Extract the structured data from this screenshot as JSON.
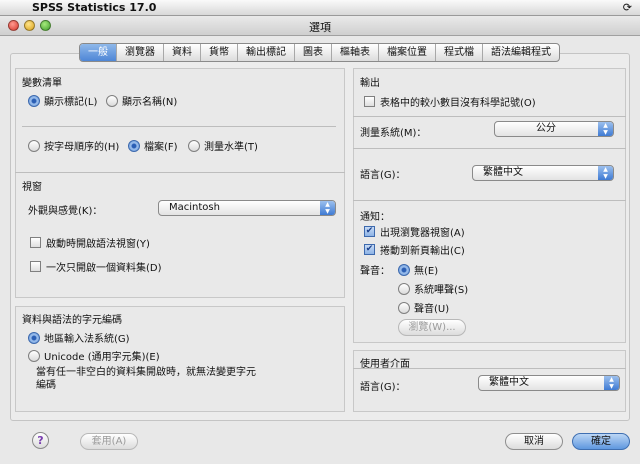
{
  "menubar": {
    "apple": "",
    "app_name": "SPSS Statistics 17.0",
    "sync_icon": "⟳"
  },
  "window": {
    "title": "選項"
  },
  "tabs": [
    "一般",
    "瀏覽器",
    "資料",
    "貨幣",
    "輸出標記",
    "圖表",
    "樞軸表",
    "檔案位置",
    "程式檔",
    "語法編輯程式"
  ],
  "variable_list": {
    "title": "變數清單",
    "display_labels": "顯示標記(L)",
    "display_names": "顯示名稱(N)",
    "alphabetical": "按字母順序的(H)",
    "file": "檔案(F)",
    "measurement_level": "測量水準(T)"
  },
  "windows": {
    "title": "視窗",
    "look_feel_label": "外觀與感覺(K)：",
    "look_feel_value": "Macintosh",
    "open_syntax": "啟動時開啟語法視窗(Y)",
    "open_one_dataset": "一次只開啟一個資料集(D)"
  },
  "encoding": {
    "title": "資料與語法的字元編碼",
    "locale": "地區輸入法系統(G)",
    "unicode": "Unicode (通用字元集)(E)",
    "note_line1": "當有任一非空白的資料集開啟時，就無法變更字元",
    "note_line2": "編碼"
  },
  "output": {
    "title": "輸出",
    "no_scientific": "表格中的較小數目沒有科學記號(O)",
    "measurement_label": "測量系統(M)：",
    "measurement_value": "公分",
    "language_label": "語言(G)：",
    "language_value": "繁體中文",
    "notify_label": "通知：",
    "popup_viewer": "出現瀏覽器視窗(A)",
    "scroll_new_output": "捲動到新頁輸出(C)",
    "sound_label": "聲音：",
    "sound_none": "無(E)",
    "sound_system": "系統嗶聲(S)",
    "sound_sound": "聲音(U)",
    "browse_button": "瀏覽(W)..."
  },
  "ui": {
    "title": "使用者介面",
    "language_label": "語言(G)：",
    "language_value": "繁體中文"
  },
  "footer": {
    "help": "?",
    "apply": "套用(A)",
    "cancel": "取消",
    "ok": "確定"
  },
  "colors": {
    "accent": "#4e86d6",
    "window_bg": "#e8e8e8"
  }
}
